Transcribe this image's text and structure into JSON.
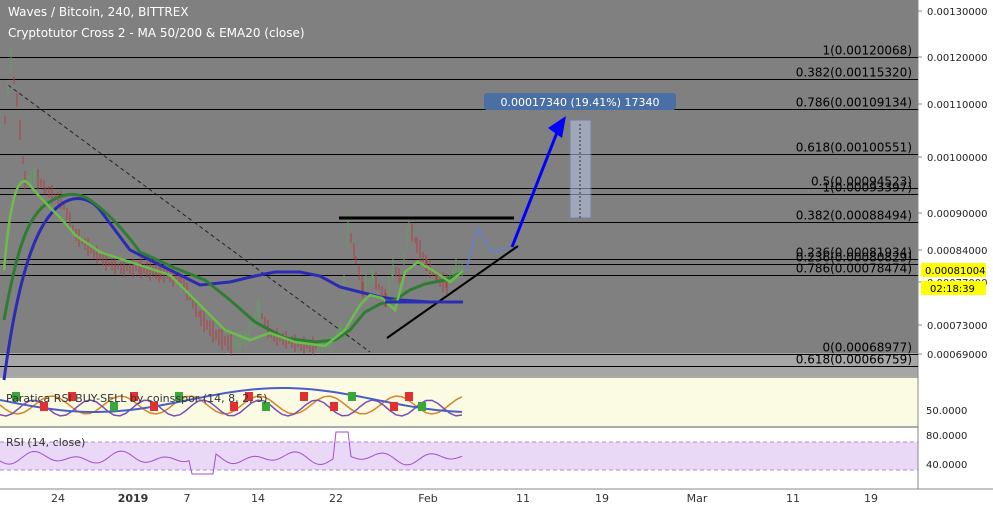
{
  "header": {
    "title": "Waves / Bitcoin, 240, BITTREX",
    "subtitle": "Cryptotutor Cross 2 - MA 50/200 & EMA20 (close)"
  },
  "chart_data": [
    {
      "type": "candlestick",
      "title": "Waves / Bitcoin, 240, BITTREX",
      "indicator": "Cryptotutor Cross 2 - MA 50/200 & EMA20 (close)",
      "x_ticks": [
        "24",
        "2019",
        "7",
        "14",
        "22",
        "Feb",
        "11",
        "19",
        "Mar",
        "11",
        "19"
      ],
      "y_ticks": [
        "0.00130000",
        "0.00120000",
        "0.00110000",
        "0.00100000",
        "0.00090000",
        "0.00084000",
        "0.00077000",
        "0.00073000",
        "0.00069000"
      ],
      "y_range": [
        0.00064,
        0.00133
      ],
      "last_price": "0.00081004",
      "countdown": "02:18:39",
      "fibonacci_levels": [
        {
          "ratio": "1",
          "value": 0.00120068,
          "label": "1(0.00120068)"
        },
        {
          "ratio": "0.382",
          "value": 0.0011532,
          "label": "0.382(0.00115320)"
        },
        {
          "ratio": "0.786",
          "value": 0.00109134,
          "label": "0.786(0.00109134)"
        },
        {
          "ratio": "0.618",
          "value": 0.00100551,
          "label": "0.618(0.00100551)"
        },
        {
          "ratio": "0.5",
          "value": 0.00094523,
          "label": "0.5(0.00094523)"
        },
        {
          "ratio": "1",
          "value": 0.00093397,
          "label": "1(0.00093397)"
        },
        {
          "ratio": "0.382",
          "value": 0.00088494,
          "label": "0.382(0.00088494)"
        },
        {
          "ratio": "0.236",
          "value": 0.00081934,
          "label": "0.236(0.00081934)"
        },
        {
          "ratio": "0.236",
          "value": 0.00080829,
          "label": "0.236(0.00080829)"
        },
        {
          "ratio": "0.786",
          "value": 0.00078474,
          "label": "0.786(0.00078474)"
        },
        {
          "ratio": "0",
          "value": 0.00068977,
          "label": "0(0.00068977)"
        },
        {
          "ratio": "0.618",
          "value": 0.00066759,
          "label": "0.618(0.00066759)"
        }
      ],
      "measure_label": "0.00017340 (19.41%) 17340",
      "series": [
        {
          "name": "MA 200",
          "color": "#2b2bb5"
        },
        {
          "name": "MA 50",
          "color": "#2e7d32"
        },
        {
          "name": "EMA 20",
          "color": "#6abf4b"
        }
      ]
    },
    {
      "type": "line",
      "title": "Paratica RSI BUY-SELL by coinsspor (14, 8, 2, 5)",
      "y_ticks": [
        "50.0000"
      ]
    },
    {
      "type": "line",
      "title": "RSI (14, close)",
      "y_ticks": [
        "80.0000",
        "40.0000"
      ],
      "y_range": [
        26,
        90
      ]
    }
  ],
  "colors": {
    "price_panel": "#808080",
    "rsi_band": "#e9d9f7",
    "buy_sell_panel": "#fbfbe3",
    "price_tag": "#ffff00",
    "measure_tag": "#4a6fa5",
    "arrow": "#0000ff"
  }
}
